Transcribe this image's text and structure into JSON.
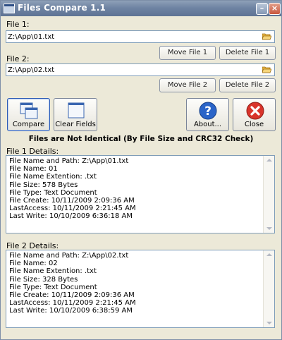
{
  "window": {
    "title": "Files Compare 1.1"
  },
  "file1": {
    "label": "File 1:",
    "value": "Z:\\App\\01.txt",
    "move_label": "Move File 1",
    "delete_label": "Delete File 1"
  },
  "file2": {
    "label": "File 2:",
    "value": "Z:\\App\\02.txt",
    "move_label": "Move File 2",
    "delete_label": "Delete File 2"
  },
  "toolbar": {
    "compare_label": "Compare",
    "clear_label": "Clear Fields",
    "about_label": "About...",
    "close_label": "Close"
  },
  "status": "Files are Not Identical (By File Size and CRC32 Check)",
  "details1": {
    "label": "File 1 Details:",
    "lines": [
      "File Name and Path: Z:\\App\\01.txt",
      "File Name: 01",
      "File Name Extention: .txt",
      "File Size: 578 Bytes",
      "File Type: Text Document",
      "File Create: 10/11/2009 2:09:36 AM",
      "LastAccess: 10/11/2009 2:21:45 AM",
      "Last Write: 10/10/2009 6:36:18 AM"
    ]
  },
  "details2": {
    "label": "File 2 Details:",
    "lines": [
      "File Name and Path: Z:\\App\\02.txt",
      "File Name: 02",
      "File Name Extention: .txt",
      "File Size: 328 Bytes",
      "File Type: Text Document",
      "File Create: 10/11/2009 2:09:36 AM",
      "LastAccess: 10/11/2009 2:21:45 AM",
      "Last Write: 10/10/2009 6:38:59 AM"
    ]
  },
  "colors": {
    "titlebar": "#6f84a3",
    "about_blue": "#2a64c8",
    "close_red": "#d9342b"
  }
}
